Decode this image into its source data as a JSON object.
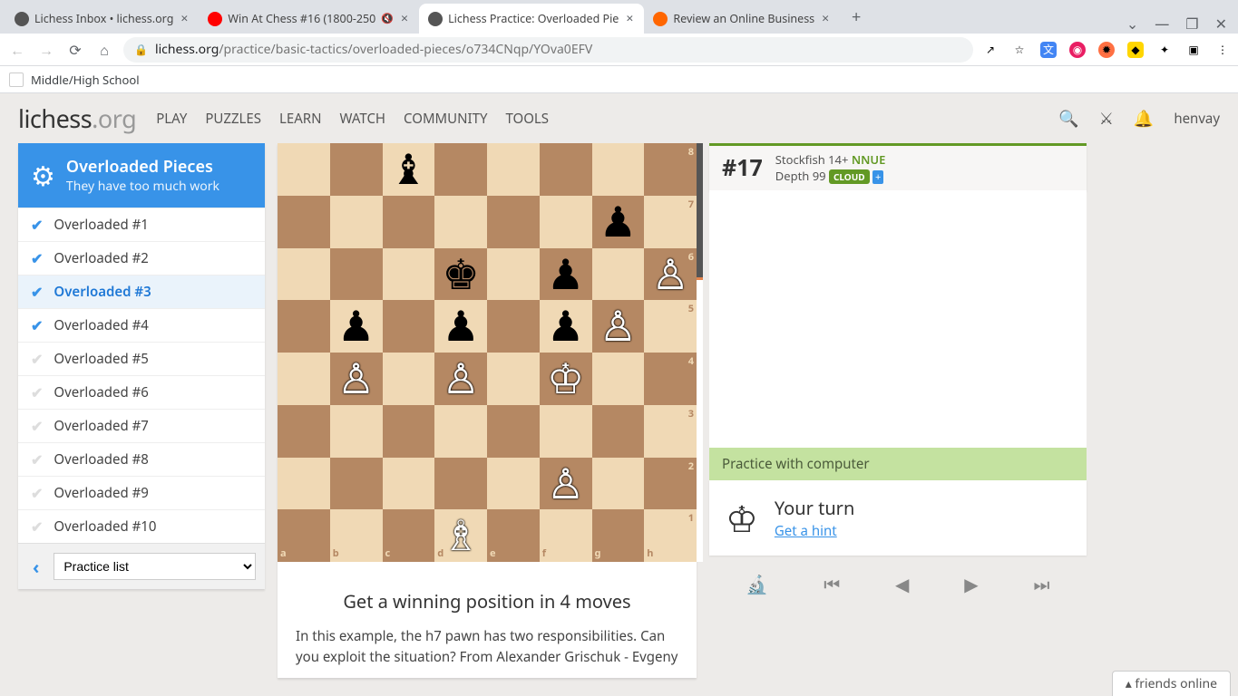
{
  "browser": {
    "tabs": [
      {
        "title": "Lichess Inbox • lichess.org",
        "fav_color": "#555"
      },
      {
        "title": "Win At Chess #16 (1800-250",
        "fav_color": "#f00",
        "sound": "🔇"
      },
      {
        "title": "Lichess Practice: Overloaded Pie",
        "fav_color": "#555",
        "active": true
      },
      {
        "title": "Review an Online Business",
        "fav_color": "#f60"
      }
    ],
    "url_domain": "lichess.org",
    "url_path": "/practice/basic-tactics/overloaded-pieces/o734CNqp/YOva0EFV",
    "bookmark": "Middle/High School"
  },
  "header": {
    "logo_a": "lichess",
    "logo_b": ".org",
    "menu": [
      "PLAY",
      "PUZZLES",
      "LEARN",
      "WATCH",
      "COMMUNITY",
      "TOOLS"
    ],
    "user": "henvay"
  },
  "sidebar": {
    "title": "Overloaded Pieces",
    "subtitle": "They have too much work",
    "items": [
      {
        "label": "Overloaded #1",
        "done": true
      },
      {
        "label": "Overloaded #2",
        "done": true
      },
      {
        "label": "Overloaded #3",
        "done": true,
        "active": true
      },
      {
        "label": "Overloaded #4",
        "done": true
      },
      {
        "label": "Overloaded #5",
        "done": false
      },
      {
        "label": "Overloaded #6",
        "done": false
      },
      {
        "label": "Overloaded #7",
        "done": false
      },
      {
        "label": "Overloaded #8",
        "done": false
      },
      {
        "label": "Overloaded #9",
        "done": false
      },
      {
        "label": "Overloaded #10",
        "done": false
      }
    ],
    "select_label": "Practice list"
  },
  "board": {
    "files": [
      "a",
      "b",
      "c",
      "d",
      "e",
      "f",
      "g",
      "h"
    ],
    "ranks": [
      "8",
      "7",
      "6",
      "5",
      "4",
      "3",
      "2",
      "1"
    ],
    "pieces": [
      {
        "sq": "c8",
        "sym": "♝",
        "color": "b"
      },
      {
        "sq": "g7",
        "sym": "♟",
        "color": "b"
      },
      {
        "sq": "d6",
        "sym": "♚",
        "color": "b"
      },
      {
        "sq": "f6",
        "sym": "♟",
        "color": "b"
      },
      {
        "sq": "h6",
        "sym": "♙",
        "color": "w"
      },
      {
        "sq": "b5",
        "sym": "♟",
        "color": "b"
      },
      {
        "sq": "d5",
        "sym": "♟",
        "color": "b"
      },
      {
        "sq": "f5",
        "sym": "♟",
        "color": "b"
      },
      {
        "sq": "g5",
        "sym": "♙",
        "color": "w"
      },
      {
        "sq": "b4",
        "sym": "♙",
        "color": "w"
      },
      {
        "sq": "d4",
        "sym": "♙",
        "color": "w"
      },
      {
        "sq": "f4",
        "sym": "♔",
        "color": "w"
      },
      {
        "sq": "f2",
        "sym": "♙",
        "color": "w"
      },
      {
        "sq": "d1",
        "sym": "♗",
        "color": "w"
      }
    ],
    "goal": "Get a winning position in 4 moves",
    "desc": "In this example, the h7 pawn has two responsibilities. Can you exploit the situation? From Alexander Grischuk - Evgeny"
  },
  "engine": {
    "eval": "#17",
    "name": "Stockfish 14+",
    "nnue": "NNUE",
    "depth_label": "Depth",
    "depth": "99",
    "cloud": "CLOUD",
    "plus": "+"
  },
  "practice": {
    "bar": "Practice with computer",
    "your_turn": "Your turn",
    "hint": "Get a hint"
  },
  "friends": "friends online"
}
